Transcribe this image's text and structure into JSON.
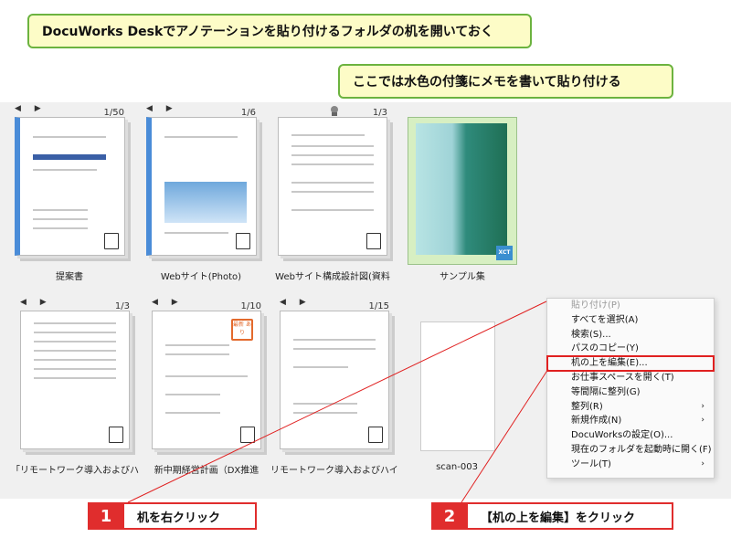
{
  "callouts": {
    "top": "DocuWorks Deskでアノテーションを貼り付けるフォルダの机を開いておく",
    "sub": "ここでは水色の付箋にメモを書いて貼り付ける"
  },
  "items": [
    {
      "label": "提案書",
      "count": "1/50",
      "nav": "◀ ▶"
    },
    {
      "label": "Webサイト(Photo)",
      "count": "1/6",
      "nav": "◀ ▶"
    },
    {
      "label": "Webサイト構成設計図(資料",
      "count": "1/3",
      "nav": ""
    },
    {
      "label": "サンプル集",
      "count": "",
      "nav": "",
      "icon": "XCT"
    },
    {
      "label": "「リモートワーク導入およびハイ",
      "count": "1/3",
      "nav": "◀ ▶"
    },
    {
      "label": "新中期経営計画（DX推進",
      "count": "1/10",
      "nav": "◀ ▶",
      "stamp": "最新 あり"
    },
    {
      "label": "リモートワーク導入およびハイブ",
      "count": "1/15",
      "nav": "◀ ▶"
    },
    {
      "label": "scan-003",
      "count": "",
      "nav": ""
    }
  ],
  "context_menu": [
    {
      "label": "貼り付け(P)",
      "disabled": true
    },
    {
      "label": "すべてを選択(A)"
    },
    {
      "label": "検索(S)..."
    },
    {
      "label": "パスのコピー(Y)"
    },
    {
      "label": "机の上を編集(E)...",
      "highlight": true
    },
    {
      "label": "お仕事スペースを開く(T)"
    },
    {
      "label": "等間隔に整列(G)"
    },
    {
      "label": "整列(R)",
      "submenu": true
    },
    {
      "label": "新規作成(N)",
      "submenu": true
    },
    {
      "label": "DocuWorksの設定(O)..."
    },
    {
      "label": "現在のフォルダを起動時に開く(F)"
    },
    {
      "label": "ツール(T)",
      "submenu": true
    }
  ],
  "steps": [
    {
      "number": "1",
      "text": "机を右クリック"
    },
    {
      "number": "2",
      "text": "【机の上を編集】をクリック"
    }
  ],
  "colors": {
    "accent_red": "#e02d2d",
    "callout_bg": "#fdfcc7",
    "callout_border": "#6cb33f"
  }
}
